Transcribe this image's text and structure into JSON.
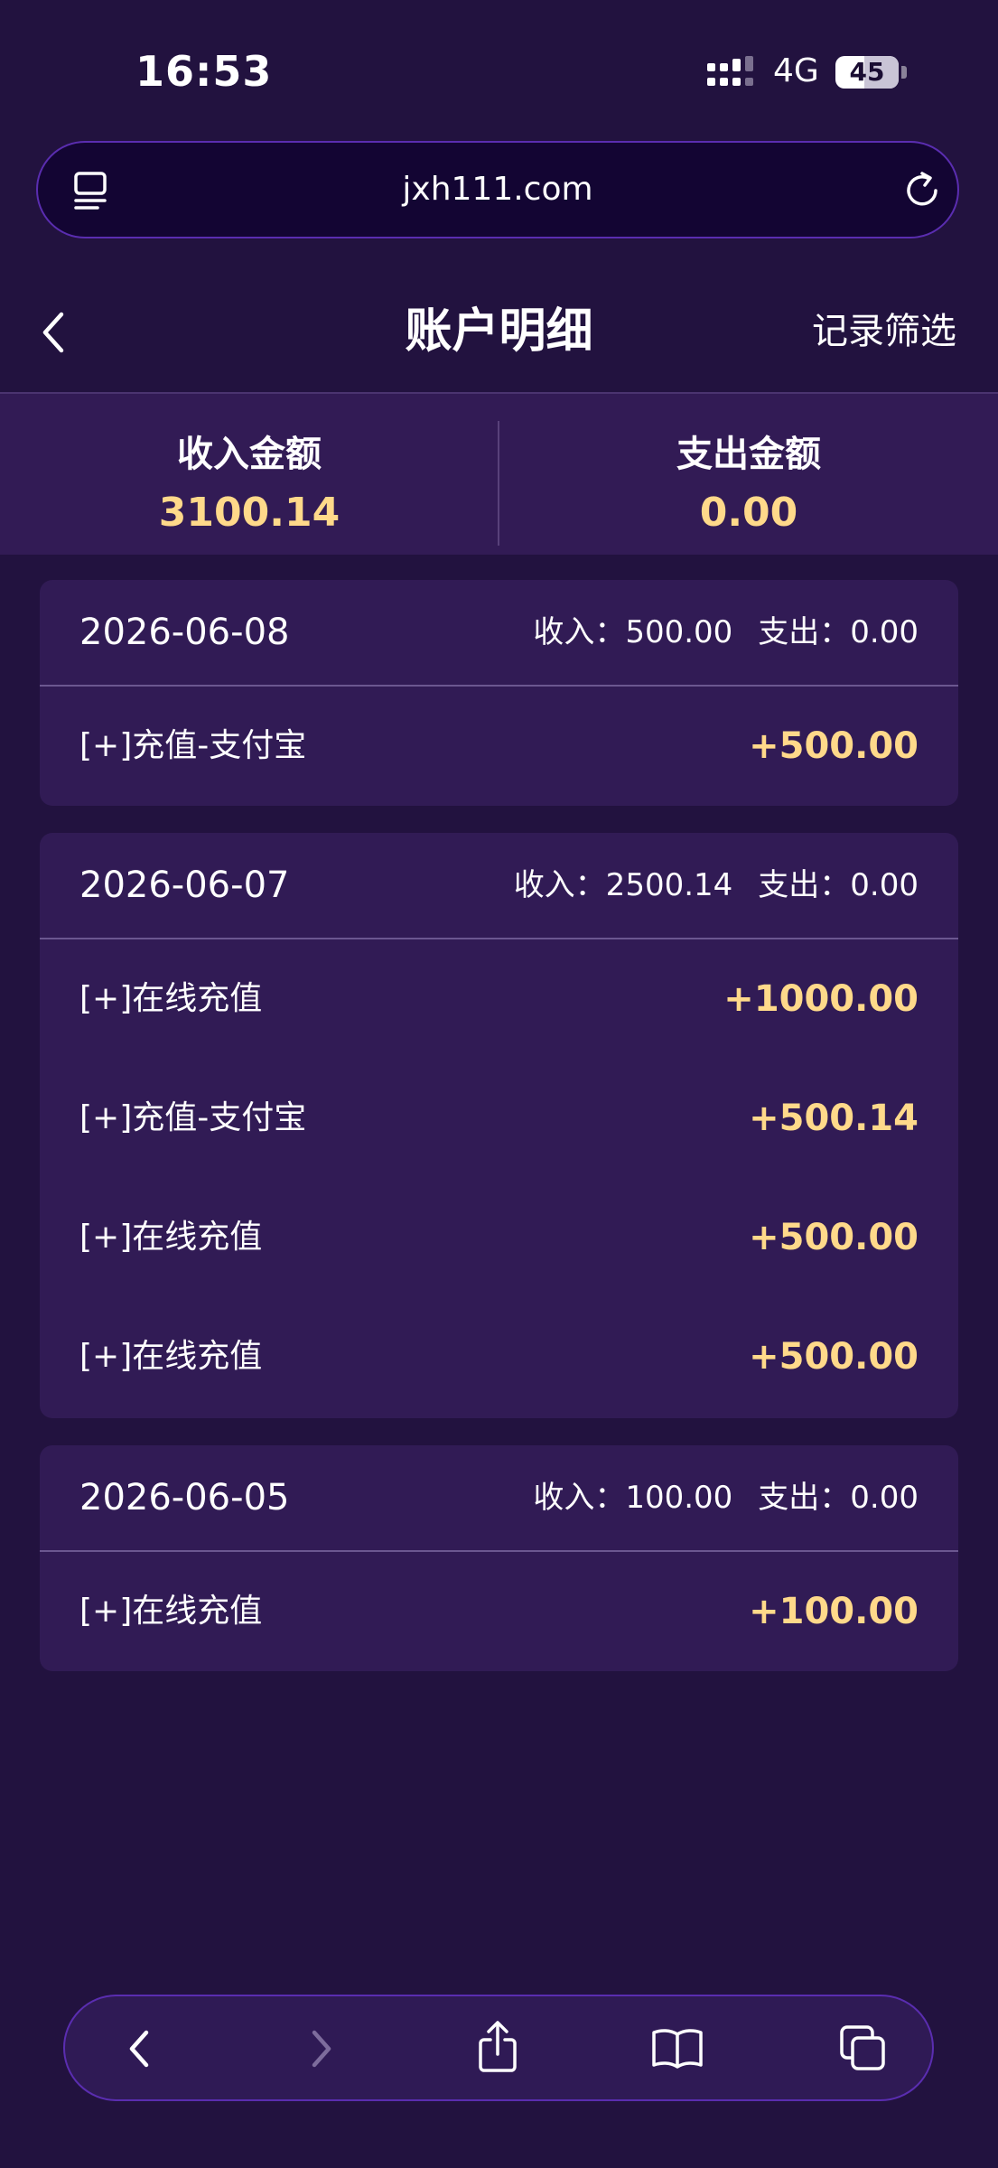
{
  "status_bar": {
    "time": "16:53",
    "network": "4G",
    "battery": "45",
    "battery_level": 0.45
  },
  "browser": {
    "url": "jxh111.com",
    "icons": {
      "reader": "reader-icon",
      "reload": "reload-icon"
    }
  },
  "header": {
    "back_icon": "chevron-left-icon",
    "title": "账户明细",
    "filter_label": "记录筛选"
  },
  "summary": {
    "income_label": "收入金额",
    "income_value": "3100.14",
    "expense_label": "支出金额",
    "expense_value": "0.00"
  },
  "days": [
    {
      "date": "2026-06-08",
      "income": "收入：500.00",
      "expense": "支出：0.00",
      "items": [
        {
          "label": "[+]充值-支付宝",
          "amount": "+500.00"
        }
      ]
    },
    {
      "date": "2026-06-07",
      "income": "收入：2500.14",
      "expense": "支出：0.00",
      "items": [
        {
          "label": "[+]在线充值",
          "amount": "+1000.00"
        },
        {
          "label": "[+]充值-支付宝",
          "amount": "+500.14"
        },
        {
          "label": "[+]在线充值",
          "amount": "+500.00"
        },
        {
          "label": "[+]在线充值",
          "amount": "+500.00"
        }
      ]
    },
    {
      "date": "2026-06-05",
      "income": "收入：100.00",
      "expense": "支出：0.00",
      "items": [
        {
          "label": "[+]在线充值",
          "amount": "+100.00"
        }
      ]
    }
  ],
  "toolbar": {
    "icons": [
      "back-arrow-icon",
      "forward-arrow-icon",
      "share-icon",
      "bookmarks-icon",
      "tabs-icon"
    ]
  },
  "colors": {
    "background": "#22123f",
    "card": "#311b55",
    "accent": "#ffd98a",
    "border": "#5a2db0"
  }
}
